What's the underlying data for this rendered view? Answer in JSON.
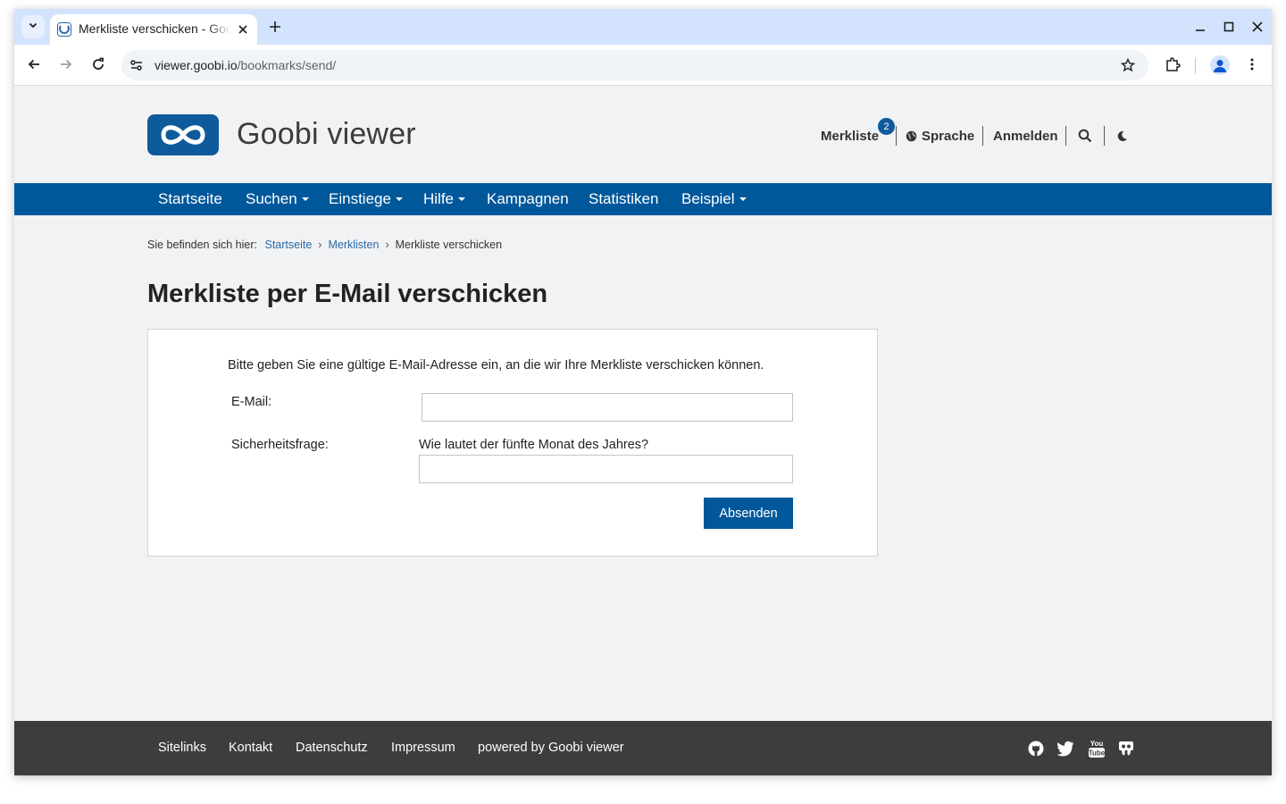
{
  "browser": {
    "tab_title": "Merkliste verschicken - Goobi viewer",
    "url_host": "viewer.goobi.io",
    "url_path": "/bookmarks/send/"
  },
  "header": {
    "site_name": "Goobi viewer",
    "bookmarks_label": "Merkliste",
    "bookmarks_count": "2",
    "language_label": "Sprache",
    "login_label": "Anmelden"
  },
  "mainnav": {
    "items": [
      {
        "label": "Startseite",
        "dropdown": false
      },
      {
        "label": "Suchen",
        "dropdown": true
      },
      {
        "label": "Einstiege",
        "dropdown": true
      },
      {
        "label": "Hilfe",
        "dropdown": true
      },
      {
        "label": "Kampagnen",
        "dropdown": false
      },
      {
        "label": "Statistiken",
        "dropdown": false
      },
      {
        "label": "Beispiel",
        "dropdown": true
      }
    ]
  },
  "breadcrumb": {
    "prefix": "Sie befinden sich hier:",
    "items": [
      "Startseite",
      "Merklisten",
      "Merkliste verschicken"
    ]
  },
  "page": {
    "title": "Merkliste per E-Mail verschicken"
  },
  "form": {
    "intro": "Bitte geben Sie eine gültige E-Mail-Adresse ein, an die wir Ihre Merkliste verschicken können.",
    "email_label": "E-Mail:",
    "email_value": "",
    "security_label": "Sicherheitsfrage:",
    "security_question": "Wie lautet der fünfte Monat des Jahres?",
    "security_value": "",
    "submit_label": "Absenden"
  },
  "footer": {
    "links": [
      "Sitelinks",
      "Kontakt",
      "Datenschutz",
      "Impressum",
      "powered by Goobi viewer"
    ],
    "social_icons": [
      "github-icon",
      "twitter-icon",
      "youtube-icon",
      "slideshare-icon"
    ]
  },
  "colors": {
    "brand_blue": "#00589b",
    "footer_bg": "#3d3d3d",
    "page_bg": "#f1f2f4"
  }
}
